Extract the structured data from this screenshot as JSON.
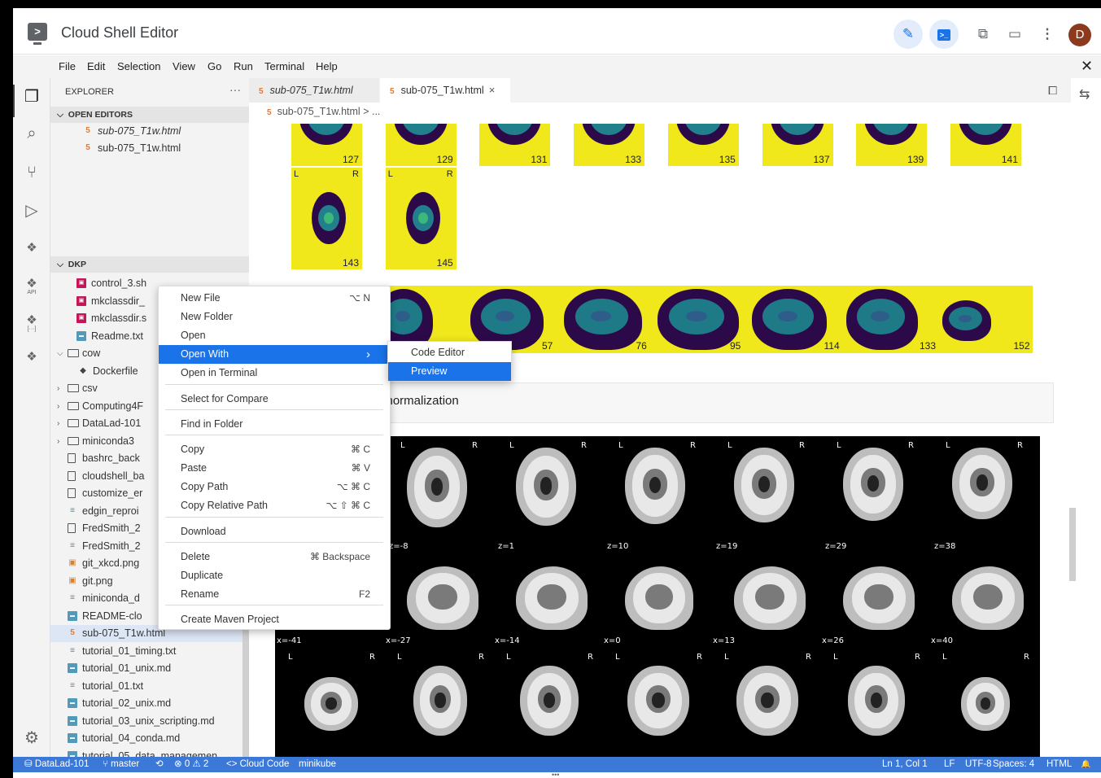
{
  "app": {
    "title": "Cloud Shell Editor",
    "avatar_initial": "D"
  },
  "menubar": [
    "File",
    "Edit",
    "Selection",
    "View",
    "Go",
    "Run",
    "Terminal",
    "Help"
  ],
  "explorer": {
    "title": "EXPLORER",
    "open_editors_label": "OPEN EDITORS",
    "open_editors": [
      "sub-075_T1w.html",
      "sub-075_T1w.html"
    ],
    "workspace_label": "DKP",
    "tree": [
      {
        "label": "control_3.sh",
        "icon": "sh"
      },
      {
        "label": "mkclassdir_",
        "icon": "sh"
      },
      {
        "label": "mkclassdir.s",
        "icon": "sh"
      },
      {
        "label": "Readme.txt",
        "icon": "md"
      },
      {
        "label": "cow",
        "icon": "folder-open"
      },
      {
        "label": "Dockerfile",
        "icon": "docker"
      },
      {
        "label": "csv",
        "icon": "folder"
      },
      {
        "label": "Computing4F",
        "icon": "folder"
      },
      {
        "label": "DataLad-101",
        "icon": "folder"
      },
      {
        "label": "miniconda3",
        "icon": "folder"
      },
      {
        "label": "bashrc_back",
        "icon": "file"
      },
      {
        "label": "cloudshell_ba",
        "icon": "file"
      },
      {
        "label": "customize_er",
        "icon": "file"
      },
      {
        "label": "edgin_reproi",
        "icon": "txt"
      },
      {
        "label": "FredSmith_2",
        "icon": "file"
      },
      {
        "label": "FredSmith_2",
        "icon": "txt"
      },
      {
        "label": "git_xkcd.png",
        "icon": "img"
      },
      {
        "label": "git.png",
        "icon": "img"
      },
      {
        "label": "miniconda_d",
        "icon": "txt"
      },
      {
        "label": "README-clo",
        "icon": "md"
      },
      {
        "label": "sub-075_T1w.html",
        "icon": "html"
      },
      {
        "label": "tutorial_01_timing.txt",
        "icon": "txt"
      },
      {
        "label": "tutorial_01_unix.md",
        "icon": "md"
      },
      {
        "label": "tutorial_01.txt",
        "icon": "txt"
      },
      {
        "label": "tutorial_02_unix.md",
        "icon": "md"
      },
      {
        "label": "tutorial_03_unix_scripting.md",
        "icon": "md"
      },
      {
        "label": "tutorial_04_conda.md",
        "icon": "md"
      },
      {
        "label": "tutorial_05_data_managemen...",
        "icon": "md"
      }
    ]
  },
  "tabs": [
    {
      "label": "sub-075_T1w.html",
      "italic": true
    },
    {
      "label": "sub-075_T1w.html",
      "active": true,
      "close": "×"
    }
  ],
  "breadcrumb": {
    "file": "sub-075_T1w.html",
    "sep": ">",
    "more": "..."
  },
  "preview": {
    "axial_top_numbers": [
      "127",
      "129",
      "131",
      "133",
      "135",
      "137",
      "139",
      "141"
    ],
    "axial_second_numbers": [
      "143",
      "145"
    ],
    "lr": {
      "l": "L",
      "r": "R"
    },
    "sagittal_numbers": [
      "57",
      "76",
      "95",
      "114",
      "133",
      "152"
    ],
    "section_title": "l normalization",
    "mri_axial_labels": [
      "z=-8",
      "z=1",
      "z=10",
      "z=19",
      "z=29",
      "z=38"
    ],
    "mri_sagittal_labels": [
      "x=-41",
      "x=-27",
      "x=-14",
      "x=0",
      "x=13",
      "x=26",
      "x=40"
    ]
  },
  "context_menu": [
    {
      "label": "New File",
      "kb": "⌥ N"
    },
    {
      "label": "New Folder",
      "kb": ""
    },
    {
      "label": "Open",
      "kb": ""
    },
    {
      "label": "Open With",
      "kb": "›",
      "highlight": true
    },
    {
      "label": "Open in Terminal",
      "kb": ""
    },
    {
      "label": "Select for Compare",
      "kb": ""
    },
    {
      "label": "Find in Folder",
      "kb": ""
    },
    {
      "label": "Copy",
      "kb": "⌘ C"
    },
    {
      "label": "Paste",
      "kb": "⌘ V"
    },
    {
      "label": "Copy Path",
      "kb": "⌥ ⌘ C"
    },
    {
      "label": "Copy Relative Path",
      "kb": "⌥ ⇧ ⌘ C"
    },
    {
      "label": "Download",
      "kb": ""
    },
    {
      "label": "Delete",
      "kb": "⌘ Backspace"
    },
    {
      "label": "Duplicate",
      "kb": ""
    },
    {
      "label": "Rename",
      "kb": "F2"
    },
    {
      "label": "Create Maven Project",
      "kb": ""
    }
  ],
  "submenu": [
    {
      "label": "Code Editor"
    },
    {
      "label": "Preview",
      "highlight": true
    }
  ],
  "status": {
    "repo": "DataLad-101",
    "branch": "master",
    "sync": "⟲",
    "problems": "⊗ 0 ⚠ 2",
    "cloud_code": "<> Cloud Code",
    "cluster": "minikube",
    "position": "Ln 1, Col 1",
    "eol": "LF",
    "encoding": "UTF-8",
    "indent": "Spaces: 4",
    "language": "HTML",
    "bell": "🔔"
  },
  "colors": {
    "accent": "#1a73e8",
    "status_bar": "#3c79d6",
    "viridis_yellow": "#f1e81c",
    "viridis_purple": "#2c0a4a"
  }
}
